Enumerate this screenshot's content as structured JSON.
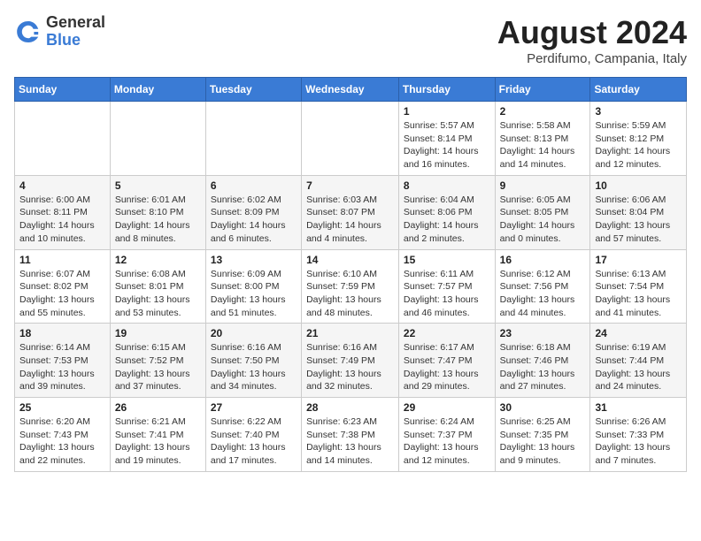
{
  "logo": {
    "general": "General",
    "blue": "Blue"
  },
  "title": {
    "month_year": "August 2024",
    "location": "Perdifumo, Campania, Italy"
  },
  "days_of_week": [
    "Sunday",
    "Monday",
    "Tuesday",
    "Wednesday",
    "Thursday",
    "Friday",
    "Saturday"
  ],
  "weeks": [
    [
      {
        "day": "",
        "info": ""
      },
      {
        "day": "",
        "info": ""
      },
      {
        "day": "",
        "info": ""
      },
      {
        "day": "",
        "info": ""
      },
      {
        "day": "1",
        "info": "Sunrise: 5:57 AM\nSunset: 8:14 PM\nDaylight: 14 hours\nand 16 minutes."
      },
      {
        "day": "2",
        "info": "Sunrise: 5:58 AM\nSunset: 8:13 PM\nDaylight: 14 hours\nand 14 minutes."
      },
      {
        "day": "3",
        "info": "Sunrise: 5:59 AM\nSunset: 8:12 PM\nDaylight: 14 hours\nand 12 minutes."
      }
    ],
    [
      {
        "day": "4",
        "info": "Sunrise: 6:00 AM\nSunset: 8:11 PM\nDaylight: 14 hours\nand 10 minutes."
      },
      {
        "day": "5",
        "info": "Sunrise: 6:01 AM\nSunset: 8:10 PM\nDaylight: 14 hours\nand 8 minutes."
      },
      {
        "day": "6",
        "info": "Sunrise: 6:02 AM\nSunset: 8:09 PM\nDaylight: 14 hours\nand 6 minutes."
      },
      {
        "day": "7",
        "info": "Sunrise: 6:03 AM\nSunset: 8:07 PM\nDaylight: 14 hours\nand 4 minutes."
      },
      {
        "day": "8",
        "info": "Sunrise: 6:04 AM\nSunset: 8:06 PM\nDaylight: 14 hours\nand 2 minutes."
      },
      {
        "day": "9",
        "info": "Sunrise: 6:05 AM\nSunset: 8:05 PM\nDaylight: 14 hours\nand 0 minutes."
      },
      {
        "day": "10",
        "info": "Sunrise: 6:06 AM\nSunset: 8:04 PM\nDaylight: 13 hours\nand 57 minutes."
      }
    ],
    [
      {
        "day": "11",
        "info": "Sunrise: 6:07 AM\nSunset: 8:02 PM\nDaylight: 13 hours\nand 55 minutes."
      },
      {
        "day": "12",
        "info": "Sunrise: 6:08 AM\nSunset: 8:01 PM\nDaylight: 13 hours\nand 53 minutes."
      },
      {
        "day": "13",
        "info": "Sunrise: 6:09 AM\nSunset: 8:00 PM\nDaylight: 13 hours\nand 51 minutes."
      },
      {
        "day": "14",
        "info": "Sunrise: 6:10 AM\nSunset: 7:59 PM\nDaylight: 13 hours\nand 48 minutes."
      },
      {
        "day": "15",
        "info": "Sunrise: 6:11 AM\nSunset: 7:57 PM\nDaylight: 13 hours\nand 46 minutes."
      },
      {
        "day": "16",
        "info": "Sunrise: 6:12 AM\nSunset: 7:56 PM\nDaylight: 13 hours\nand 44 minutes."
      },
      {
        "day": "17",
        "info": "Sunrise: 6:13 AM\nSunset: 7:54 PM\nDaylight: 13 hours\nand 41 minutes."
      }
    ],
    [
      {
        "day": "18",
        "info": "Sunrise: 6:14 AM\nSunset: 7:53 PM\nDaylight: 13 hours\nand 39 minutes."
      },
      {
        "day": "19",
        "info": "Sunrise: 6:15 AM\nSunset: 7:52 PM\nDaylight: 13 hours\nand 37 minutes."
      },
      {
        "day": "20",
        "info": "Sunrise: 6:16 AM\nSunset: 7:50 PM\nDaylight: 13 hours\nand 34 minutes."
      },
      {
        "day": "21",
        "info": "Sunrise: 6:16 AM\nSunset: 7:49 PM\nDaylight: 13 hours\nand 32 minutes."
      },
      {
        "day": "22",
        "info": "Sunrise: 6:17 AM\nSunset: 7:47 PM\nDaylight: 13 hours\nand 29 minutes."
      },
      {
        "day": "23",
        "info": "Sunrise: 6:18 AM\nSunset: 7:46 PM\nDaylight: 13 hours\nand 27 minutes."
      },
      {
        "day": "24",
        "info": "Sunrise: 6:19 AM\nSunset: 7:44 PM\nDaylight: 13 hours\nand 24 minutes."
      }
    ],
    [
      {
        "day": "25",
        "info": "Sunrise: 6:20 AM\nSunset: 7:43 PM\nDaylight: 13 hours\nand 22 minutes."
      },
      {
        "day": "26",
        "info": "Sunrise: 6:21 AM\nSunset: 7:41 PM\nDaylight: 13 hours\nand 19 minutes."
      },
      {
        "day": "27",
        "info": "Sunrise: 6:22 AM\nSunset: 7:40 PM\nDaylight: 13 hours\nand 17 minutes."
      },
      {
        "day": "28",
        "info": "Sunrise: 6:23 AM\nSunset: 7:38 PM\nDaylight: 13 hours\nand 14 minutes."
      },
      {
        "day": "29",
        "info": "Sunrise: 6:24 AM\nSunset: 7:37 PM\nDaylight: 13 hours\nand 12 minutes."
      },
      {
        "day": "30",
        "info": "Sunrise: 6:25 AM\nSunset: 7:35 PM\nDaylight: 13 hours\nand 9 minutes."
      },
      {
        "day": "31",
        "info": "Sunrise: 6:26 AM\nSunset: 7:33 PM\nDaylight: 13 hours\nand 7 minutes."
      }
    ]
  ]
}
